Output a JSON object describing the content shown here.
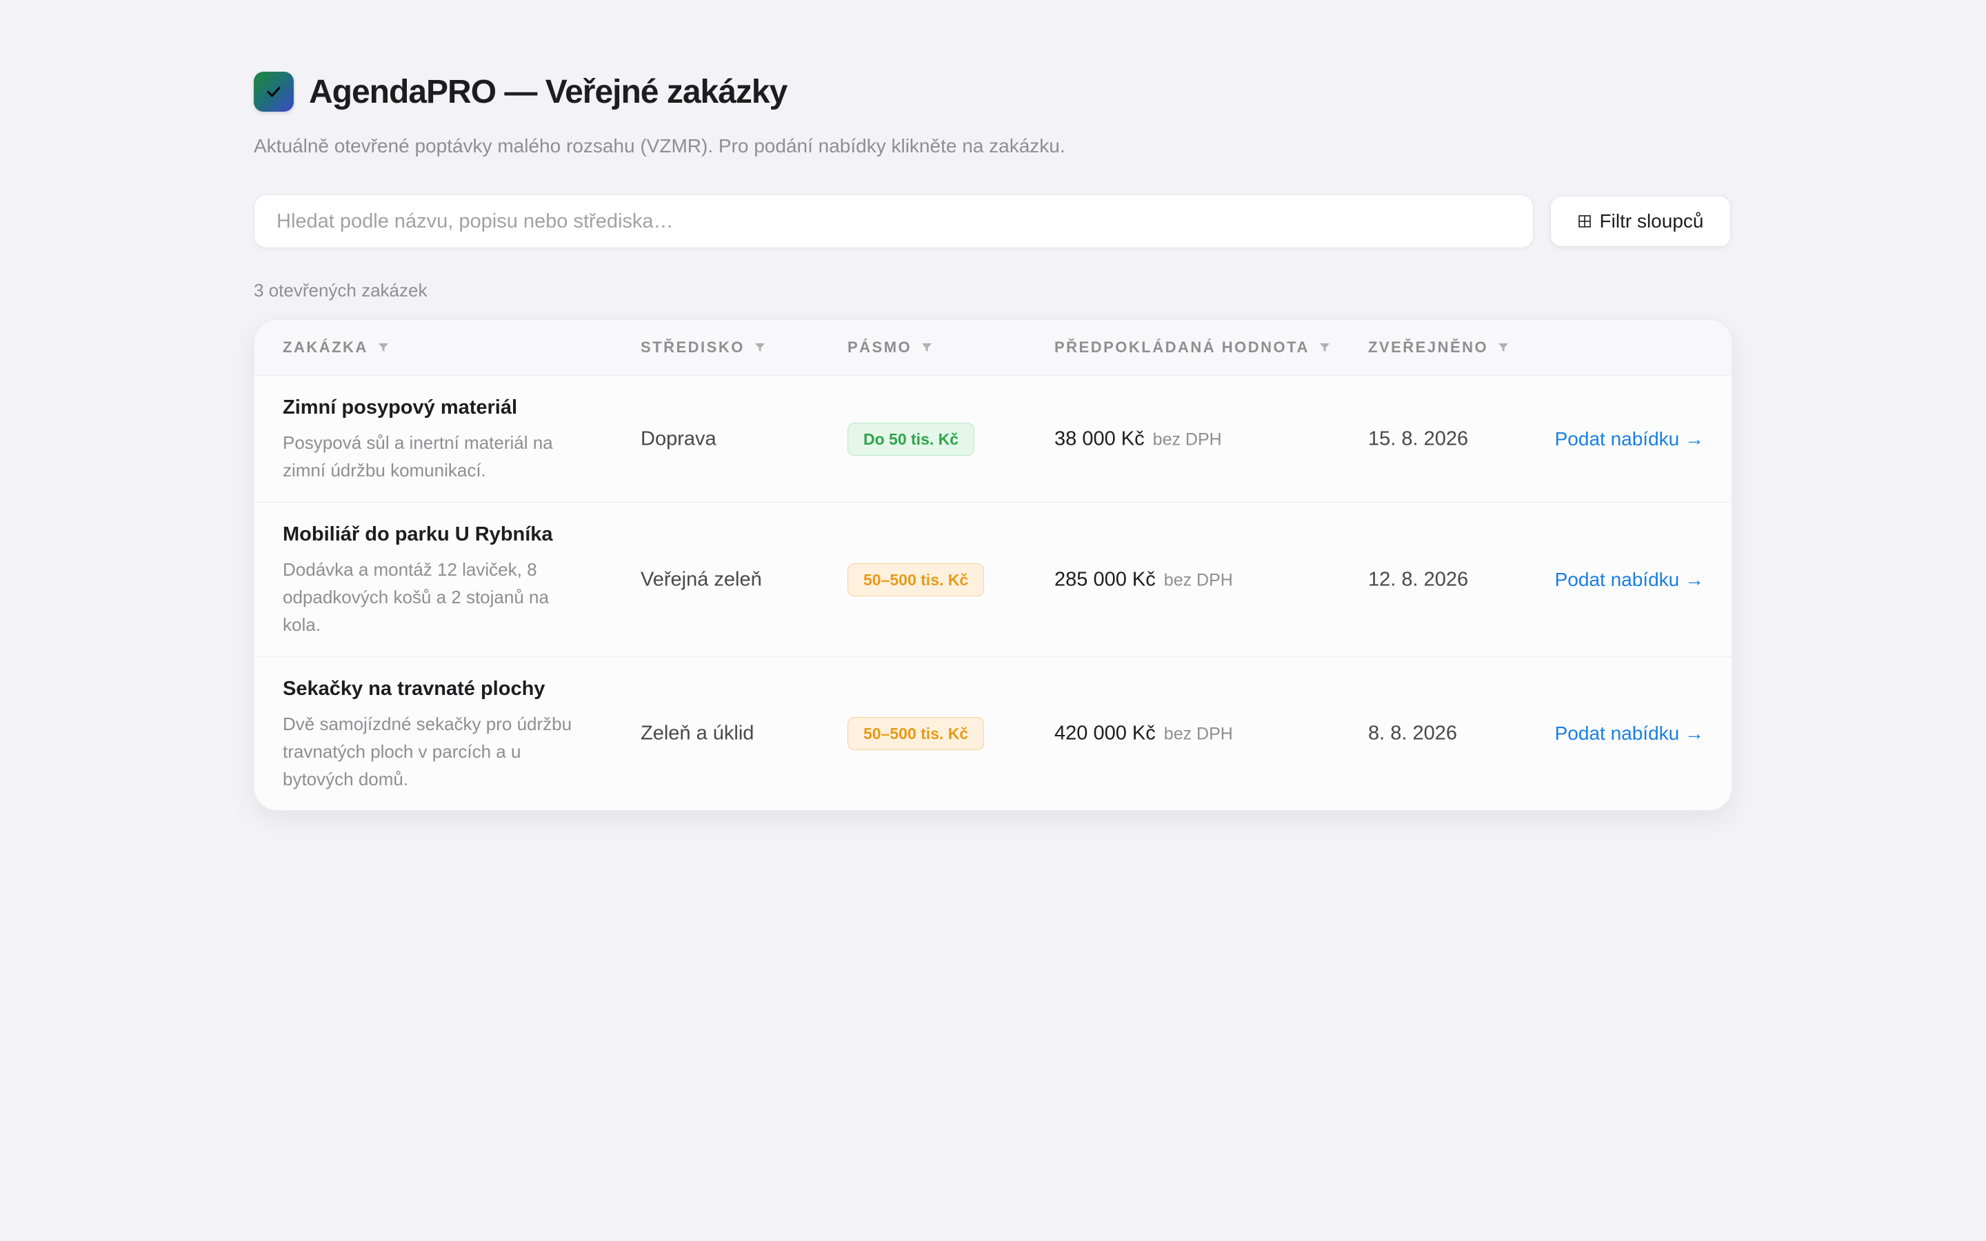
{
  "header": {
    "title": "AgendaPRO — Veřejné zakázky",
    "subtitle": "Aktuálně otevřené poptávky malého rozsahu (VZMR). Pro podání nabídky klikněte na zakázku.",
    "logo_icon": "check-icon",
    "logo_gradient": [
      "#1e8a3a",
      "#3a49c8"
    ]
  },
  "search": {
    "placeholder": "Hledat podle názvu, popisu nebo střediska…",
    "value": ""
  },
  "filter_button": {
    "label": "Filtr sloupců",
    "icon": "grid-icon"
  },
  "count_label": "3 otevřených zakázek",
  "table": {
    "columns": [
      "ZAKÁZKA",
      "STŘEDISKO",
      "PÁSMO",
      "PŘEDPOKLÁDANÁ HODNOTA",
      "ZVEŘEJNĚNO"
    ],
    "rows": [
      {
        "name": "Zimní posypový materiál",
        "description": "Posypová sůl a inertní materiál na zimní údržbu komunikací.",
        "center": "Doprava",
        "band": "Do 50 tis. Kč",
        "band_color": "#2fa54a",
        "price": "38 000 Kč",
        "vat": "bez DPH",
        "published": "15. 8. 2026",
        "action": "Podat nabídku →"
      },
      {
        "name": "Mobiliář do parku U Rybníka",
        "description": "Dodávka a montáž 12 laviček, 8 odpadkových košů a 2 stojanů na kola.",
        "center": "Veřejná zeleň",
        "band": "50–500 tis. Kč",
        "band_color": "#e79a19",
        "price": "285 000 Kč",
        "vat": "bez DPH",
        "published": "12. 8. 2026",
        "action": "Podat nabídku →"
      },
      {
        "name": "Sekačky na travnaté plochy",
        "description": "Dvě samojízdné sekačky pro údržbu travnatých ploch v parcích a u bytových domů.",
        "center": "Zeleň a úklid",
        "band": "50–500 tis. Kč",
        "band_color": "#e79a19",
        "price": "420 000 Kč",
        "vat": "bez DPH",
        "published": "8. 8. 2026",
        "action": "Podat nabídku →"
      }
    ]
  },
  "colors": {
    "accent_link": "#1a7fe0",
    "background": "#f3f3f7"
  }
}
